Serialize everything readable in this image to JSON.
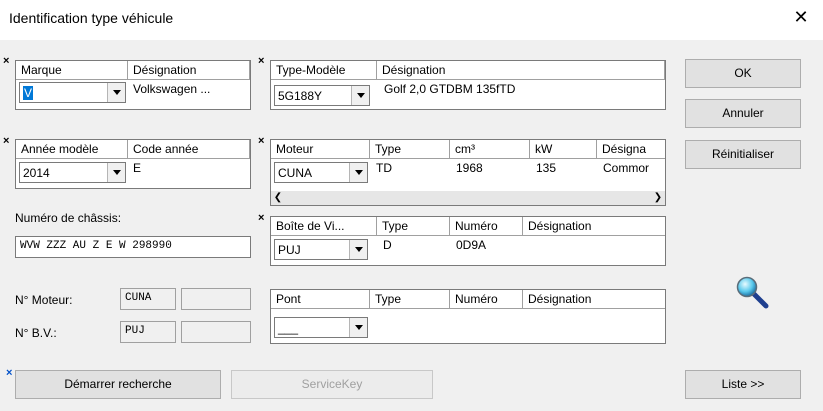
{
  "window": {
    "title": "Identification type véhicule",
    "close": "✕"
  },
  "marque": {
    "headers": [
      "Marque",
      "Désignation"
    ],
    "value": "V",
    "designation": "Volkswagen ..."
  },
  "type_modele": {
    "headers": [
      "Type-Modèle",
      "Désignation"
    ],
    "value": "5G188Y",
    "designation": "Golf 2,0 GTDBM 135fTD"
  },
  "annee": {
    "headers": [
      "Année modèle",
      "Code année"
    ],
    "value": "2014",
    "code": "E"
  },
  "moteur": {
    "headers": [
      "Moteur",
      "Type",
      "cm³",
      "kW",
      "Désigna"
    ],
    "value": "CUNA",
    "type": "TD",
    "cm3": "1968",
    "kw": "135",
    "designation": "Commor"
  },
  "chassis": {
    "label": "Numéro de châssis:",
    "value": "WVW ZZZ AU Z E W 298990"
  },
  "boite": {
    "headers": [
      "Boîte de Vi...",
      "Type",
      "Numéro",
      "Désignation"
    ],
    "value": "PUJ",
    "type": "D",
    "numero": "0D9A"
  },
  "n_moteur": {
    "label": "N° Moteur:",
    "value": "CUNA"
  },
  "n_bv": {
    "label": "N° B.V.:",
    "value": "PUJ"
  },
  "pont": {
    "headers": [
      "Pont",
      "Type",
      "Numéro",
      "Désignation"
    ],
    "value": "___"
  },
  "buttons": {
    "ok": "OK",
    "annuler": "Annuler",
    "reinitialiser": "Réinitialiser",
    "demarrer": "Démarrer recherche",
    "servicekey": "ServiceKey",
    "liste": "Liste >>"
  },
  "markers": {
    "required": "×"
  },
  "colors": {
    "selection": "#0078d7",
    "background": "#f0f0f0",
    "required_blue": "#0050c8"
  }
}
